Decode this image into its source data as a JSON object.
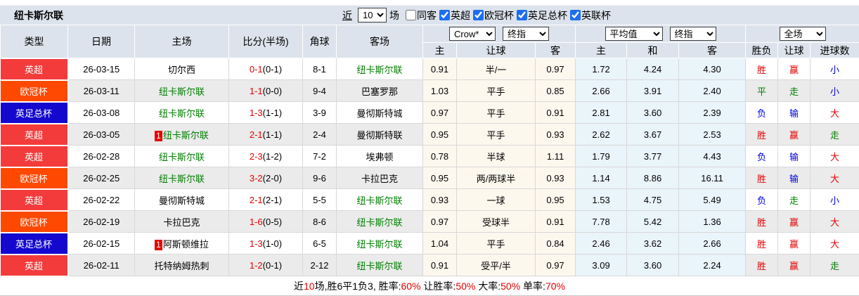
{
  "palette": {
    "red": "#e60000",
    "green": "#008000",
    "blue": "#0000e0",
    "black": "#000000",
    "epl": "#f43b3b",
    "ucl": "#ff4800",
    "facup": "#1408cf"
  },
  "title": "纽卡斯尔联",
  "controls": {
    "recent_label": "近",
    "recent_value": "10",
    "matches_label": "场",
    "same_venue_label": "同客",
    "same_venue_checked": false,
    "leagues": [
      {
        "label": "英超",
        "checked": true
      },
      {
        "label": "欧冠杯",
        "checked": true
      },
      {
        "label": "英足总杯",
        "checked": true
      },
      {
        "label": "英联杯",
        "checked": true
      }
    ]
  },
  "header": {
    "left_cols": [
      "类型",
      "日期",
      "主场",
      "比分(半场)",
      "角球",
      "客场"
    ],
    "groups": [
      {
        "selects": [
          "Crow*",
          "终指"
        ],
        "sub": [
          "主",
          "让球",
          "客"
        ]
      },
      {
        "selects": [
          "平均值",
          "终指"
        ],
        "sub": [
          "主",
          "和",
          "客"
        ]
      },
      {
        "selects": [
          "全场"
        ],
        "sub": [
          "胜负",
          "让球",
          "进球数"
        ]
      }
    ]
  },
  "rows": [
    {
      "type": "英超",
      "type_key": "epl",
      "date": "26-03-15",
      "home": {
        "name": "切尔西",
        "green": false,
        "badge": ""
      },
      "score": "0-1",
      "half": "(0-1)",
      "corner": "8-1",
      "away": {
        "name": "纽卡斯尔联",
        "green": true,
        "badge": ""
      },
      "crow": [
        "0.91",
        "半/一",
        "0.97"
      ],
      "avg": [
        "1.72",
        "4.24",
        "4.30"
      ],
      "result": [
        [
          "胜",
          "red"
        ],
        [
          "赢",
          "red"
        ],
        [
          "小",
          "blue"
        ]
      ]
    },
    {
      "type": "欧冠杯",
      "type_key": "ucl",
      "date": "26-03-11",
      "home": {
        "name": "纽卡斯尔联",
        "green": true,
        "badge": ""
      },
      "score": "1-1",
      "half": "(0-0)",
      "corner": "9-4",
      "away": {
        "name": "巴塞罗那",
        "green": false,
        "badge": ""
      },
      "crow": [
        "1.03",
        "平手",
        "0.85"
      ],
      "avg": [
        "2.66",
        "3.91",
        "2.40"
      ],
      "result": [
        [
          "平",
          "green"
        ],
        [
          "走",
          "green"
        ],
        [
          "小",
          "blue"
        ]
      ]
    },
    {
      "type": "英足总杯",
      "type_key": "facup",
      "date": "26-03-08",
      "home": {
        "name": "纽卡斯尔联",
        "green": true,
        "badge": ""
      },
      "score": "1-3",
      "half": "(1-1)",
      "corner": "3-9",
      "away": {
        "name": "曼彻斯特城",
        "green": false,
        "badge": ""
      },
      "crow": [
        "0.97",
        "平手",
        "0.91"
      ],
      "avg": [
        "2.81",
        "3.60",
        "2.39"
      ],
      "result": [
        [
          "负",
          "blue"
        ],
        [
          "输",
          "blue"
        ],
        [
          "大",
          "red"
        ]
      ]
    },
    {
      "type": "英超",
      "type_key": "epl",
      "date": "26-03-05",
      "home": {
        "name": "纽卡斯尔联",
        "green": true,
        "badge": "1"
      },
      "score": "2-1",
      "half": "(1-1)",
      "corner": "2-4",
      "away": {
        "name": "曼彻斯特联",
        "green": false,
        "badge": ""
      },
      "crow": [
        "0.95",
        "平手",
        "0.93"
      ],
      "avg": [
        "2.62",
        "3.67",
        "2.53"
      ],
      "result": [
        [
          "胜",
          "red"
        ],
        [
          "赢",
          "red"
        ],
        [
          "走",
          "green"
        ]
      ]
    },
    {
      "type": "英超",
      "type_key": "epl",
      "date": "26-02-28",
      "home": {
        "name": "纽卡斯尔联",
        "green": true,
        "badge": ""
      },
      "score": "2-3",
      "half": "(1-2)",
      "corner": "7-2",
      "away": {
        "name": "埃弗顿",
        "green": false,
        "badge": ""
      },
      "crow": [
        "0.78",
        "半球",
        "1.11"
      ],
      "avg": [
        "1.79",
        "3.77",
        "4.43"
      ],
      "result": [
        [
          "负",
          "blue"
        ],
        [
          "输",
          "blue"
        ],
        [
          "大",
          "red"
        ]
      ]
    },
    {
      "type": "欧冠杯",
      "type_key": "ucl",
      "date": "26-02-25",
      "home": {
        "name": "纽卡斯尔联",
        "green": true,
        "badge": ""
      },
      "score": "3-2",
      "half": "(2-0)",
      "corner": "9-6",
      "away": {
        "name": "卡拉巴克",
        "green": false,
        "badge": ""
      },
      "crow": [
        "0.95",
        "两/两球半",
        "0.93"
      ],
      "avg": [
        "1.14",
        "8.86",
        "16.11"
      ],
      "result": [
        [
          "胜",
          "red"
        ],
        [
          "输",
          "blue"
        ],
        [
          "大",
          "red"
        ]
      ]
    },
    {
      "type": "英超",
      "type_key": "epl",
      "date": "26-02-22",
      "home": {
        "name": "曼彻斯特城",
        "green": false,
        "badge": ""
      },
      "score": "2-1",
      "half": "(2-1)",
      "corner": "5-5",
      "away": {
        "name": "纽卡斯尔联",
        "green": true,
        "badge": ""
      },
      "crow": [
        "0.93",
        "一球",
        "0.95"
      ],
      "avg": [
        "1.53",
        "4.75",
        "5.49"
      ],
      "result": [
        [
          "负",
          "blue"
        ],
        [
          "走",
          "green"
        ],
        [
          "小",
          "blue"
        ]
      ]
    },
    {
      "type": "欧冠杯",
      "type_key": "ucl",
      "date": "26-02-19",
      "home": {
        "name": "卡拉巴克",
        "green": false,
        "badge": ""
      },
      "score": "1-6",
      "half": "(0-5)",
      "corner": "8-6",
      "away": {
        "name": "纽卡斯尔联",
        "green": true,
        "badge": ""
      },
      "crow": [
        "0.97",
        "受球半",
        "0.91"
      ],
      "avg": [
        "7.78",
        "5.42",
        "1.36"
      ],
      "result": [
        [
          "胜",
          "red"
        ],
        [
          "赢",
          "red"
        ],
        [
          "大",
          "red"
        ]
      ]
    },
    {
      "type": "英足总杯",
      "type_key": "facup",
      "date": "26-02-15",
      "home": {
        "name": "阿斯顿维拉",
        "green": false,
        "badge": "1"
      },
      "score": "1-3",
      "half": "(1-0)",
      "corner": "6-5",
      "away": {
        "name": "纽卡斯尔联",
        "green": true,
        "badge": ""
      },
      "crow": [
        "1.04",
        "平手",
        "0.84"
      ],
      "avg": [
        "2.46",
        "3.62",
        "2.66"
      ],
      "result": [
        [
          "胜",
          "red"
        ],
        [
          "赢",
          "red"
        ],
        [
          "大",
          "red"
        ]
      ]
    },
    {
      "type": "英超",
      "type_key": "epl",
      "date": "26-02-11",
      "home": {
        "name": "托特纳姆热刺",
        "green": false,
        "badge": ""
      },
      "score": "1-2",
      "half": "(0-1)",
      "corner": "2-12",
      "away": {
        "name": "纽卡斯尔联",
        "green": true,
        "badge": ""
      },
      "crow": [
        "0.91",
        "受平/半",
        "0.97"
      ],
      "avg": [
        "3.09",
        "3.60",
        "2.24"
      ],
      "result": [
        [
          "胜",
          "red"
        ],
        [
          "赢",
          "red"
        ],
        [
          "走",
          "green"
        ]
      ]
    }
  ],
  "footer": {
    "segments": [
      {
        "t": "近",
        "c": "black"
      },
      {
        "t": "10",
        "c": "red"
      },
      {
        "t": "场,胜6平1负3, 胜率:",
        "c": "black"
      },
      {
        "t": "60%",
        "c": "red"
      },
      {
        "t": " 让胜率:",
        "c": "black"
      },
      {
        "t": "50%",
        "c": "red"
      },
      {
        "t": " 大率:",
        "c": "black"
      },
      {
        "t": "50%",
        "c": "red"
      },
      {
        "t": " 单率:",
        "c": "black"
      },
      {
        "t": "70%",
        "c": "red"
      }
    ]
  }
}
